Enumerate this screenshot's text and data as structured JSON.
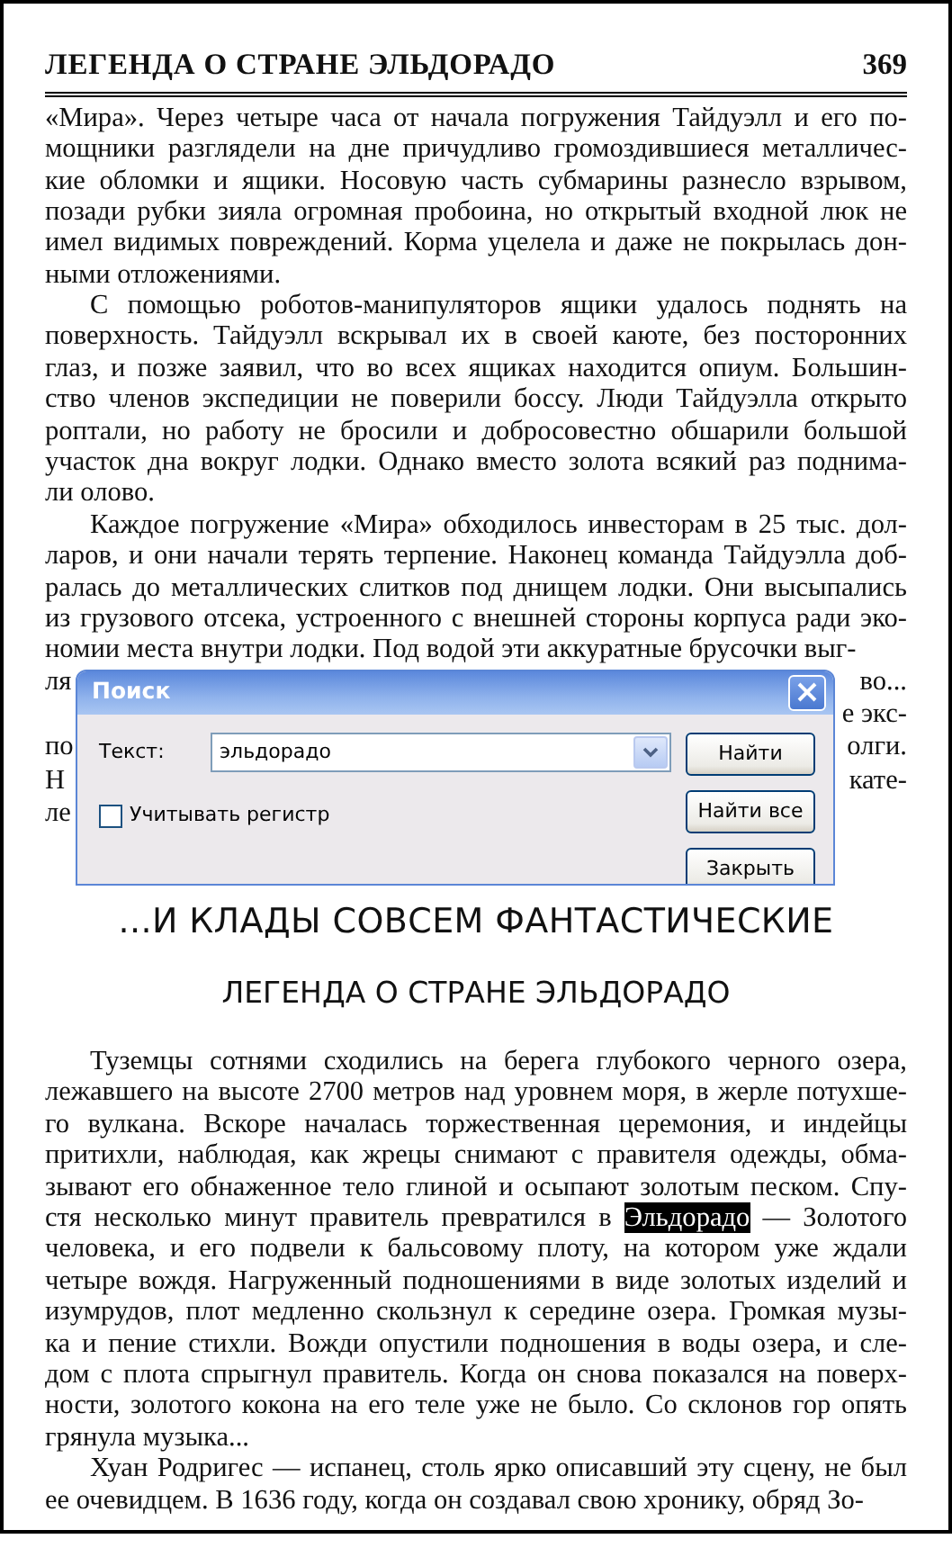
{
  "page_header": {
    "title": "ЛЕГЕНДА О СТРАНЕ ЭЛЬДОРАДО",
    "page_number": "369"
  },
  "body_top": [
    {
      "indent": false,
      "lines": [
        "«Мира». Через четыре часа от начала погружения Тайдуэлл и его по-",
        "мощники разглядели на дне причудливо громоздившиеся металличес-",
        "кие обломки и ящики. Носовую часть субмарины разнесло взрывом,",
        "позади рубки зияла огромная пробоина, но открытый входной люк не",
        "имел видимых повреждений. Корма уцелела и даже не покрылась дон-",
        "ными отложениями."
      ]
    },
    {
      "indent": true,
      "lines": [
        "С помощью роботов-манипуляторов ящики удалось поднять на",
        "поверхность. Тайдуэлл вскрывал их в своей каюте, без посторонних",
        "глаз, и позже заявил, что во всех ящиках находится опиум. Большин-",
        "ство членов экспедиции не поверили боссу. Люди Тайдуэлла открыто",
        "роптали, но работу не бросили и добросовестно обшарили большой",
        "участок дна вокруг лодки. Однако вместо золота всякий раз поднима-",
        "ли олово."
      ]
    },
    {
      "indent": true,
      "lines": [
        "Каждое погружение «Мира» обходилось инвесторам в 25 тыс. дол-",
        "ларов, и они начали терять терпение. Наконец команда Тайдуэлла доб-",
        "ралась до металлических слитков под днищем лодки. Они высыпались",
        "из грузового отсека, устроенного с внешней стороны корпуса ради эко-",
        "номии места внутри лодки. Под водой эти аккуратные брусочки выг-"
      ]
    }
  ],
  "occluded_lines": [
    {
      "left": "ля",
      "right": "во..."
    },
    {
      "right": "е экс-"
    },
    {
      "left": "по",
      "right": "олги."
    },
    {
      "left": "Н",
      "right": "кате-"
    },
    {
      "left": "ле"
    }
  ],
  "headings": [
    {
      "kind": "chapter",
      "text": "...И КЛАДЫ СОВСЕМ ФАНТАСТИЧЕСКИЕ"
    },
    {
      "kind": "section",
      "text": "ЛЕГЕНДА О СТРАНЕ ЭЛЬДОРАДО"
    }
  ],
  "body_bottom": [
    {
      "indent": true,
      "lines": [
        "Туземцы сотнями сходились на берега глубокого черного озера,",
        "лежавшего на высоте 2700 метров над уровнем моря, в жерле потухше-",
        "го вулкана. Вскоре началась торжественная церемония, и индейцы",
        "притихли, наблюдая, как жрецы снимают с правителя одежды, обма-",
        "зывают его обнаженное тело глиной и осыпают золотым песком. Спу-",
        [
          {
            "text": "стя несколько минут правитель превратился в ",
            "highlighted": false
          },
          {
            "text": "Эльдорадо",
            "highlighted": true
          },
          {
            "text": " — Золотого",
            "highlighted": false
          }
        ],
        "человека, и его подвели к бальсовому плоту, на котором уже ждали",
        "четыре вождя. Нагруженный подношениями в виде золотых изделий и",
        "изумрудов, плот медленно скользнул к середине озера. Громкая музы-",
        "ка и пение стихли. Вожди опустили подношения в воды озера, и сле-",
        "дом с плота спрыгнул правитель. Когда он снова показался на поверх-",
        "ности, золотого кокона на его теле уже не было. Со склонов гор опять",
        "грянула музыка..."
      ]
    },
    {
      "indent": true,
      "lines": [
        "Хуан Родригес — испанец, столь ярко описавший эту сцену, не был",
        "ее очевидцем. В 1636 году, когда он создавал свою хронику, обряд Зо-"
      ]
    }
  ],
  "dialog": {
    "title": "Поиск",
    "field_label": "Текст:",
    "field_value": "эльдорадо",
    "checkbox": {
      "label": "Учитывать регистр",
      "checked": false
    },
    "buttons": [
      "Найти",
      "Найти все",
      "Закрыть"
    ]
  }
}
